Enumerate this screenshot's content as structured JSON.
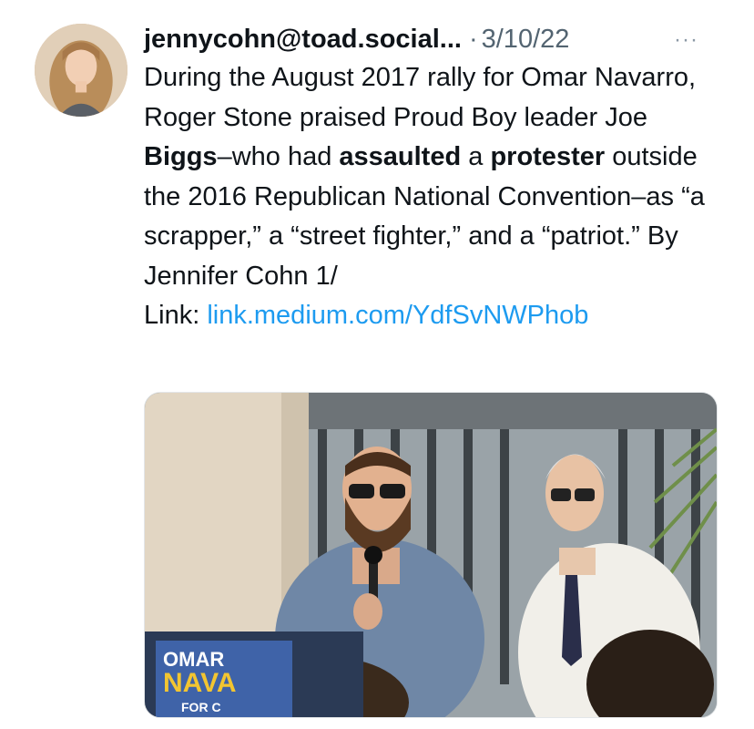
{
  "tweet": {
    "handle": "jennycohn@toad.social...",
    "separator": "·",
    "date": "3/10/22",
    "more_label": "···",
    "text": {
      "p1": "During the August 2017 rally for Omar Navarro, Roger Stone praised Proud Boy leader Joe ",
      "bold1": "Biggs",
      "p2": "–who had ",
      "bold2": "assaulted",
      "p3": " a ",
      "bold3": "protester",
      "p4": " outside the 2016 Republican National Convention–as “a scrapper,” a “street fighter,” and a “patriot.” By Jennifer Cohn 1/",
      "link_prefix": "Link: ",
      "link_text": "link.medium.com/YdfSvNWPhob"
    },
    "media": {
      "sign_line1": "OMAR",
      "sign_line2": "NAVA",
      "sign_line3": "FOR C"
    }
  },
  "colors": {
    "text": "#0f1419",
    "muted": "#536471",
    "link": "#1d9bf0"
  }
}
